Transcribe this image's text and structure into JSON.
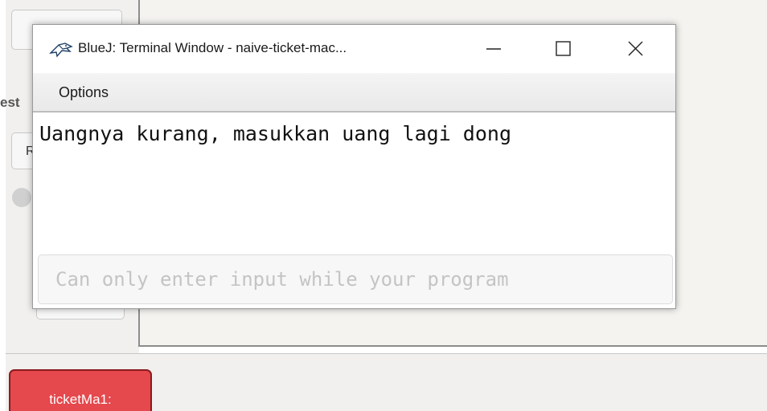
{
  "background": {
    "test_label": "est",
    "small_button_label": "R",
    "object_chip_label": "ticketMa1:"
  },
  "terminal": {
    "title": "BlueJ: Terminal Window - naive-ticket-mac...",
    "app_icon": "bluej-bird-icon",
    "controls": {
      "minimize_icon": "minimize-icon",
      "maximize_icon": "maximize-icon",
      "close_icon": "close-icon"
    },
    "menu": {
      "options_label": "Options"
    },
    "output_text": "Uangnya kurang, masukkan uang lagi dong",
    "input_placeholder": "Can only enter input while your program"
  },
  "colors": {
    "object_chip_fill": "#e5484d",
    "panel_bg": "#f1f0ee"
  }
}
